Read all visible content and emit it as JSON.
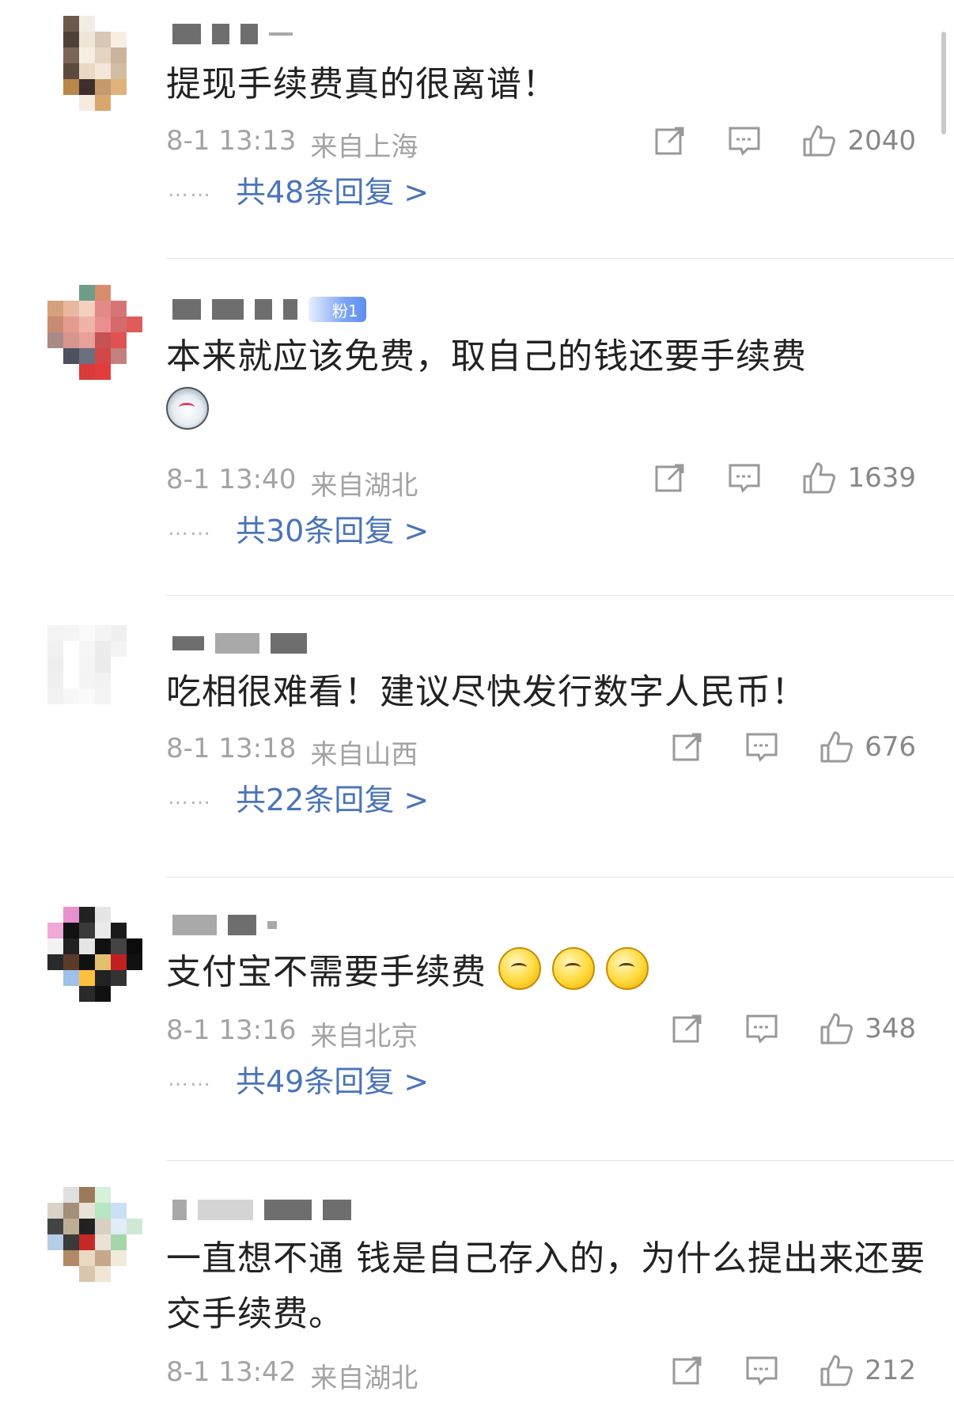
{
  "comments": [
    {
      "text": "提现手续费真的很离谱！",
      "time": "8-1 13:13",
      "location": "来自上海",
      "likes": "2040",
      "replies": "共48条回复 >"
    },
    {
      "badge": "粉1",
      "text": "本来就应该免费，取自己的钱还要手续费",
      "time": "8-1 13:40",
      "location": "来自湖北",
      "likes": "1639",
      "replies": "共30条回复 >"
    },
    {
      "text": "吃相很难看！建议尽快发行数字人民币！",
      "time": "8-1 13:18",
      "location": "来自山西",
      "likes": "676",
      "replies": "共22条回复 >"
    },
    {
      "text": "支付宝不需要手续费",
      "time": "8-1 13:16",
      "location": "来自北京",
      "likes": "348",
      "replies": "共49条回复 >"
    },
    {
      "text": "一直想不通 钱是自己存入的，为什么提出来还要交手续费。",
      "time": "8-1 13:42",
      "location": "来自湖北",
      "likes": "212"
    }
  ],
  "reply_dots": "……",
  "icons": [
    "share-icon",
    "comment-icon",
    "like-icon",
    "dog-emoji-icon",
    "thinking-emoji-icon"
  ],
  "colors": {
    "link": "#4a74b8",
    "meta": "#a3a3a3",
    "text": "#222222"
  }
}
